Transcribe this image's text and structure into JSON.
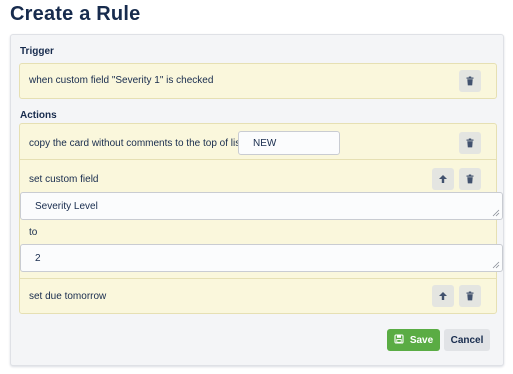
{
  "page": {
    "title": "Create a Rule"
  },
  "trigger": {
    "label": "Trigger",
    "text": "when custom field \"Severity 1\" is checked",
    "delete_icon": "trash-icon"
  },
  "actions": {
    "label": "Actions",
    "items": [
      {
        "text": "copy the card without comments to the top of list",
        "list_value": "NEW",
        "delete_icon": "trash-icon"
      },
      {
        "text": "set custom field",
        "field_value": "Severity Level",
        "connector": "to",
        "value": "2",
        "move_up_icon": "arrow-up-icon",
        "delete_icon": "trash-icon"
      },
      {
        "text": "set due tomorrow",
        "move_up_icon": "arrow-up-icon",
        "delete_icon": "trash-icon"
      }
    ]
  },
  "footer": {
    "save_label": "Save",
    "save_icon": "save-icon",
    "cancel_label": "Cancel"
  },
  "colors": {
    "title": "#172b4d",
    "section_bg": "#faf7dc",
    "panel_bg": "#f4f5f7",
    "save": "#5aac44",
    "cancel": "#e1e3e6"
  }
}
